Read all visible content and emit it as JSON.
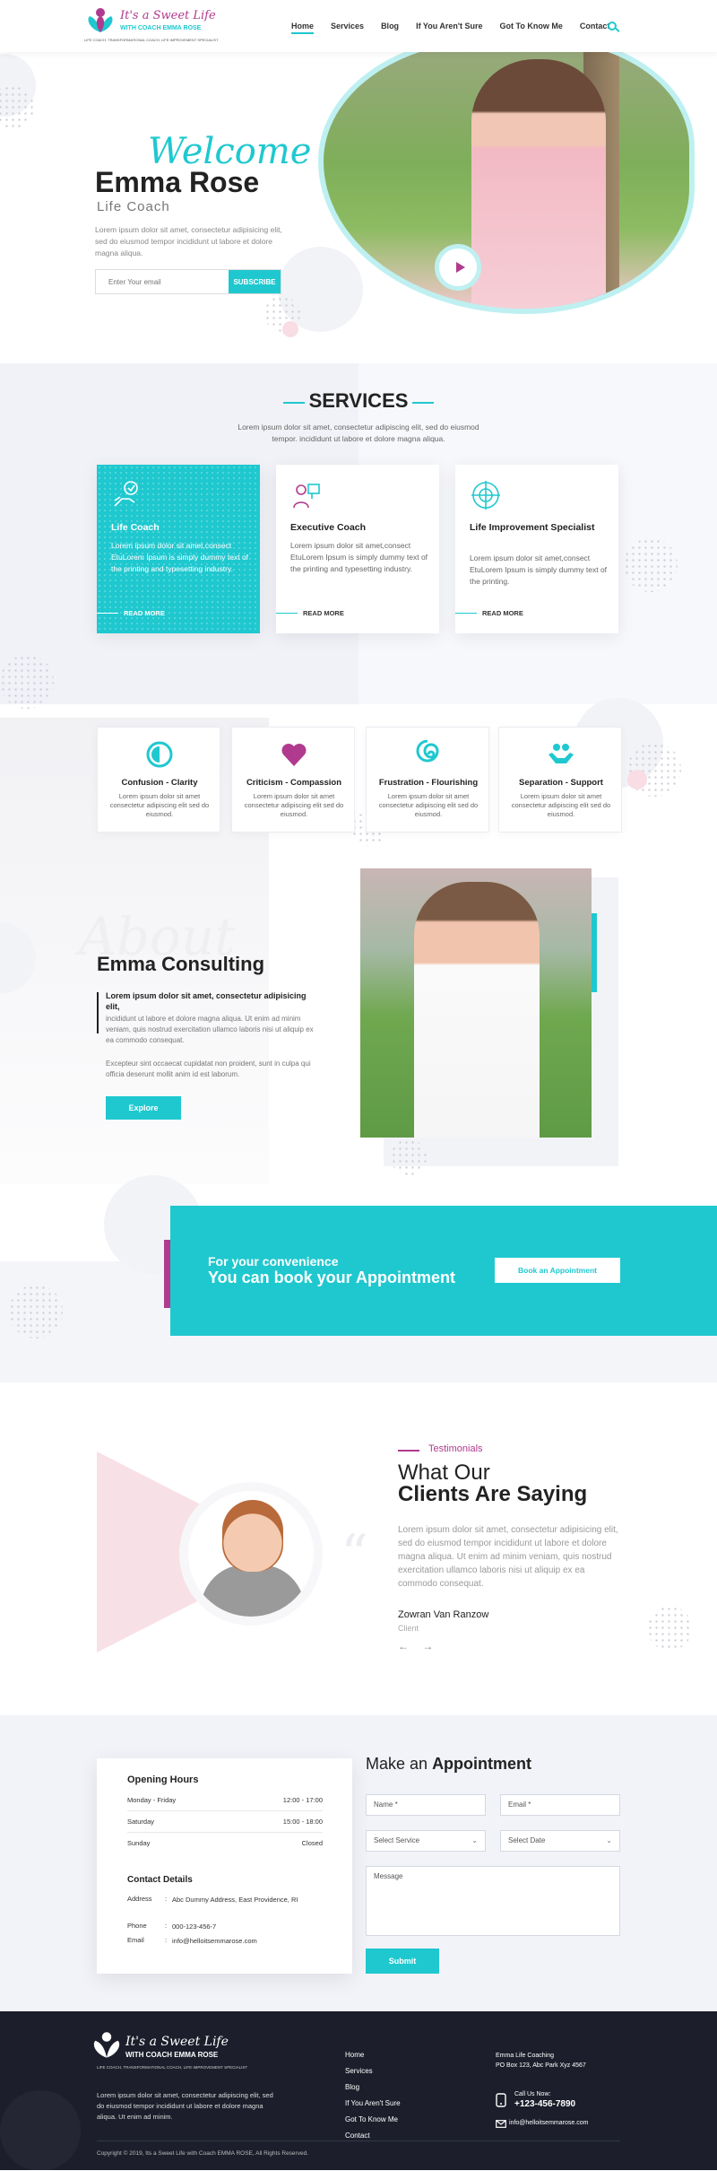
{
  "brand": {
    "script": "It's a Sweet Life",
    "sub": "WITH COACH EMMA ROSE",
    "tagline": "LIFE COACH, TRANSFORMATIONAL COACH, LIFE IMPROVEMENT SPECIALIST"
  },
  "nav": {
    "items": [
      "Home",
      "Services",
      "Blog",
      "If You Aren't Sure",
      "Got To Know Me",
      "Contact"
    ],
    "active": "Home"
  },
  "hero": {
    "welcome": "Welcome",
    "name": "Emma Rose",
    "role": "Life Coach",
    "text": "Lorem ipsum dolor sit amet, consectetur adipisicing elit, sed do eiusmod tempor incididunt ut labore et dolore magna aliqua.",
    "email_placeholder": "Enter Your email",
    "subscribe": "SUBSCRIBE"
  },
  "services": {
    "title": "SERVICES",
    "desc": "Lorem ipsum dolor sit amet, consectetur adipiscing elit, sed do eiusmod tempor. incididunt ut labore et dolore magna aliqua.",
    "cards": [
      {
        "title": "Life Coach",
        "text": "Lorem ipsum dolor sit amet,consect EtuLorem Ipsum is simply dummy text of the printing and typesetting industry.",
        "more": "READ MORE"
      },
      {
        "title": "Executive Coach",
        "text": "Lorem ipsum dolor sit amet,consect EtuLorem Ipsum is simply dummy text of the printing and typesetting industry.",
        "more": "READ MORE"
      },
      {
        "title": "Life Improvement Specialist",
        "text": "Lorem ipsum dolor sit amet,consect EtuLorem Ipsum is simply dummy text of the printing.",
        "more": "READ MORE"
      }
    ]
  },
  "features": [
    {
      "title": "Confusion - Clarity",
      "text": "Lorem ipsum dolor sit amet consectetur adipiscing elit sed do eiusmod."
    },
    {
      "title": "Criticism - Compassion",
      "text": "Lorem ipsum dolor sit amet consectetur adipiscing elit sed do eiusmod."
    },
    {
      "title": "Frustration - Flourishing",
      "text": "Lorem ipsum dolor sit amet consectetur adipiscing elit sed do eiusmod."
    },
    {
      "title": "Separation - Support",
      "text": "Lorem ipsum dolor sit amet consectetur adipiscing elit sed do eiusmod."
    }
  ],
  "about": {
    "script": "About",
    "title": "Emma Consulting",
    "lead": "Lorem ipsum dolor sit amet, consectetur adipisicing elit,",
    "p1": "incididunt ut labore et dolore magna aliqua. Ut enim ad minim veniam, quis nostrud exercitation ullamco laboris nisi ut aliquip ex ea commodo consequat.",
    "p2": "Excepteur sint occaecat cupidatat non proident, sunt in culpa qui officia deserunt mollit anim id est laborum.",
    "button": "Explore"
  },
  "banner": {
    "small": "For your convenience",
    "big": "You can book your Appointment",
    "button": "Book an Appointment"
  },
  "testimonials": {
    "tag": "Testimonials",
    "title1": "What Our",
    "title2": "Clients Are Saying",
    "text": "Lorem ipsum dolor sit amet, consectetur adipisicing elit, sed do eiusmod tempor incididunt ut labore et dolore magna aliqua. Ut enim ad minim veniam, quis nostrud exercitation ullamco laboris nisi ut aliquip ex ea commodo consequat.",
    "name": "Zowran Van Ranzow",
    "role": "Client",
    "arrows": "← →"
  },
  "hours": {
    "title": "Opening Hours",
    "rows": [
      {
        "day": "Monday - Friday",
        "time": "12:00 - 17:00"
      },
      {
        "day": "Saturday",
        "time": "15:00 - 18:00"
      },
      {
        "day": "Sunday",
        "time": "Closed"
      }
    ]
  },
  "contact": {
    "title": "Contact Details",
    "address_label": "Address",
    "address": "Abc Dummy Address, East Providence, RI",
    "phone_label": "Phone",
    "phone": "000-123-456-7",
    "email_label": "Email",
    "email": "info@helloitsemmarose.com",
    "sep": ":"
  },
  "appointment": {
    "title_light": "Make an",
    "title_bold": "Appointment",
    "name_ph": "Name *",
    "email_ph": "Email *",
    "service_ph": "Select Service",
    "date_ph": "Select Date",
    "message_ph": "Message",
    "submit": "Submit"
  },
  "footer": {
    "text": "Lorem ipsum dolor sit amet, consectetur adipiscing elit, sed do eiusmod tempor incididunt ut labore et dolore magna aliqua. Ut enim ad minim.",
    "links": [
      "Home",
      "Services",
      "Blog",
      "If You Aren't Sure",
      "Got To Know Me",
      "Contact"
    ],
    "org": "Emma Life Coaching",
    "po": "PO Box 123, Abc Park Xyz 4567",
    "call_label": "Call Us Now:",
    "phone": "+123-456-7890",
    "email": "info@helloitsemmarose.com",
    "copyright": "Copyright © 2019, Its a Sweet Life with Coach EMMA ROSE, All Rights Reserved."
  },
  "colors": {
    "accent": "#1fc8cf",
    "brand": "#b03a8e",
    "footer": "#1c1e2b"
  }
}
